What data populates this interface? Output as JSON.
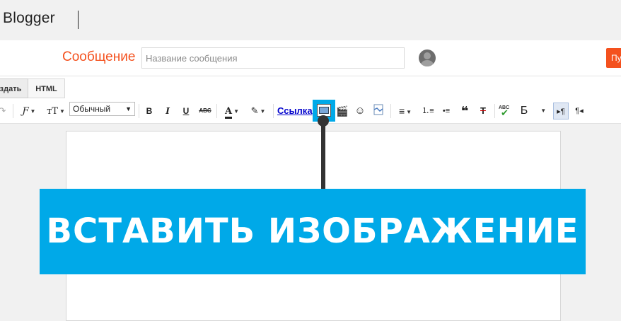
{
  "app": {
    "brand": "Blogger"
  },
  "post": {
    "label": "Сообщение",
    "title_placeholder": "Название сообщения",
    "title_value": "",
    "publish_label": "Пу"
  },
  "modes": {
    "compose": "здать",
    "html": "HTML"
  },
  "toolbar": {
    "font_family_icon": "Ƒ",
    "font_size_icon": "тT",
    "paragraph_style": "Обычный",
    "bold": "B",
    "italic": "I",
    "underline": "U",
    "strikethrough": "ABC",
    "text_color": "A",
    "link": "Ссылка",
    "quote": "❝",
    "spellcheck": "ABC",
    "transliterate": "Б",
    "ltr": "▸¶",
    "rtl": "¶◂",
    "undo_icon": "↷",
    "highlight_icon": "✎"
  },
  "callout": {
    "text": "ВСТАВИТЬ ИЗОБРАЖЕНИЕ"
  },
  "colors": {
    "accent": "#00a9e8",
    "brand_orange": "#f4511e",
    "pointer": "#333333"
  },
  "icons": [
    "undo-icon",
    "font-family-icon",
    "font-size-icon",
    "bold-icon",
    "italic-icon",
    "underline-icon",
    "strikethrough-icon",
    "text-color-icon",
    "highlight-icon",
    "insert-image-icon",
    "insert-video-icon",
    "emoji-icon",
    "jump-break-icon",
    "align-icon",
    "numbered-list-icon",
    "bullet-list-icon",
    "quote-icon",
    "remove-format-icon",
    "spellcheck-icon",
    "transliterate-icon",
    "ltr-icon",
    "rtl-icon"
  ]
}
